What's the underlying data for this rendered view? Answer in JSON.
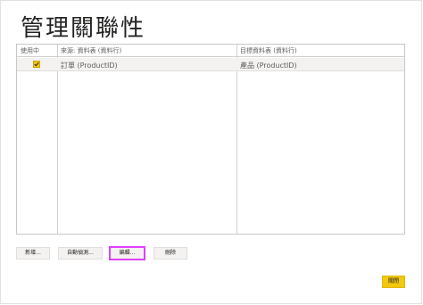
{
  "dialog": {
    "title": "管理關聯性"
  },
  "table": {
    "columns": [
      "使用中",
      "來源: 資料表 (資料行)",
      "目標資料表 (資料行)"
    ],
    "rows": [
      {
        "active": true,
        "source": "訂單 (ProductID)",
        "target": "產品 (ProductID)"
      }
    ]
  },
  "actions": {
    "new_label": "新增...",
    "autodetect_label": "自動偵測...",
    "edit_label": "編輯...",
    "delete_label": "刪除",
    "close_label": "關閉"
  },
  "colors": {
    "accent": "#f2c811",
    "highlight": "#e040fb"
  }
}
